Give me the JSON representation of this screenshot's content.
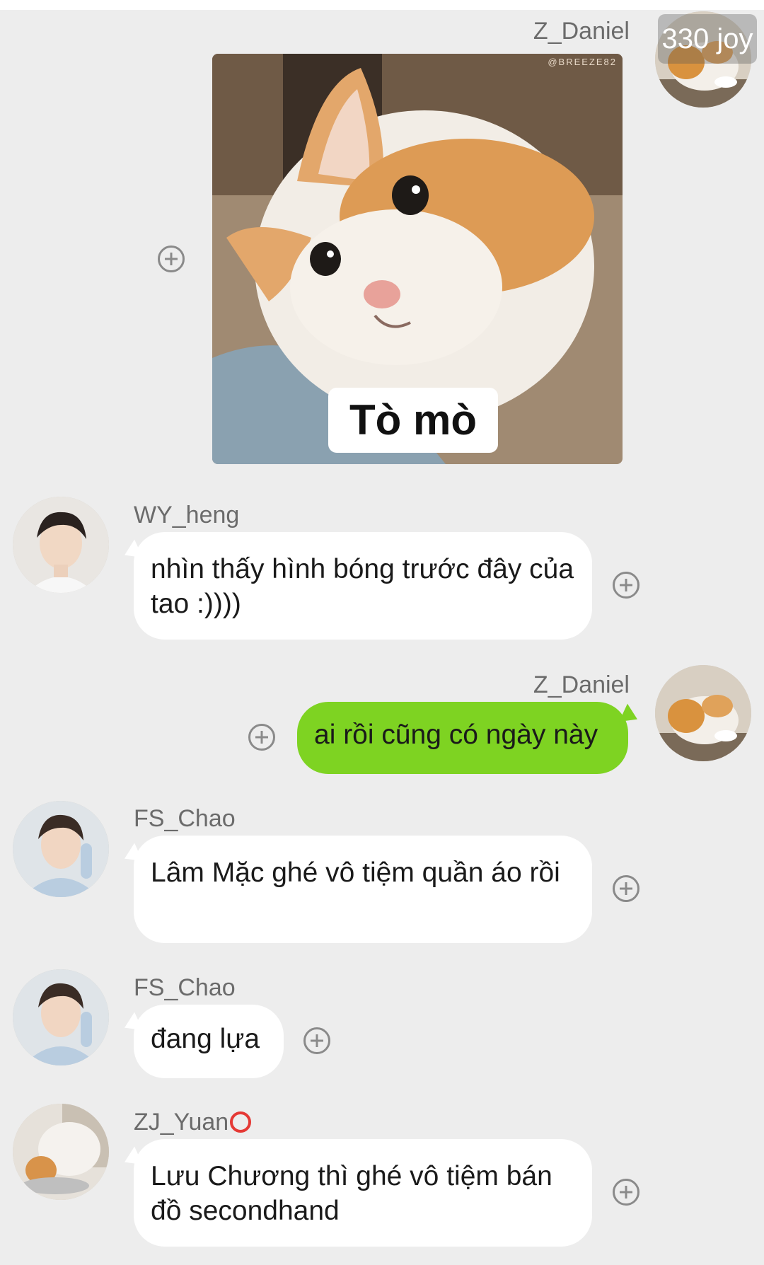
{
  "badge": {
    "text": "330 joy"
  },
  "sticker": {
    "caption": "Tò mò",
    "watermark": "@BREEZE82"
  },
  "messages": [
    {
      "sender": "Z_Daniel",
      "type": "sticker"
    },
    {
      "sender": "WY_heng",
      "text": "nhìn thấy hình bóng trước đây của tao :))))"
    },
    {
      "sender": "Z_Daniel",
      "text": "ai rồi cũng có ngày này"
    },
    {
      "sender": "FS_Chao",
      "text": "Lâm Mặc ghé vô tiệm quần áo rồi"
    },
    {
      "sender": "FS_Chao",
      "text": "đang lựa"
    },
    {
      "sender": "ZJ_Yuan",
      "text": "Lưu Chương thì ghé vô tiệm bán đồ secondhand"
    }
  ],
  "icons": {
    "add": "plus-circle-icon",
    "status": "red-circle-icon"
  },
  "colors": {
    "background": "#ededed",
    "own_bubble": "#7ed322",
    "other_bubble": "#ffffff"
  }
}
